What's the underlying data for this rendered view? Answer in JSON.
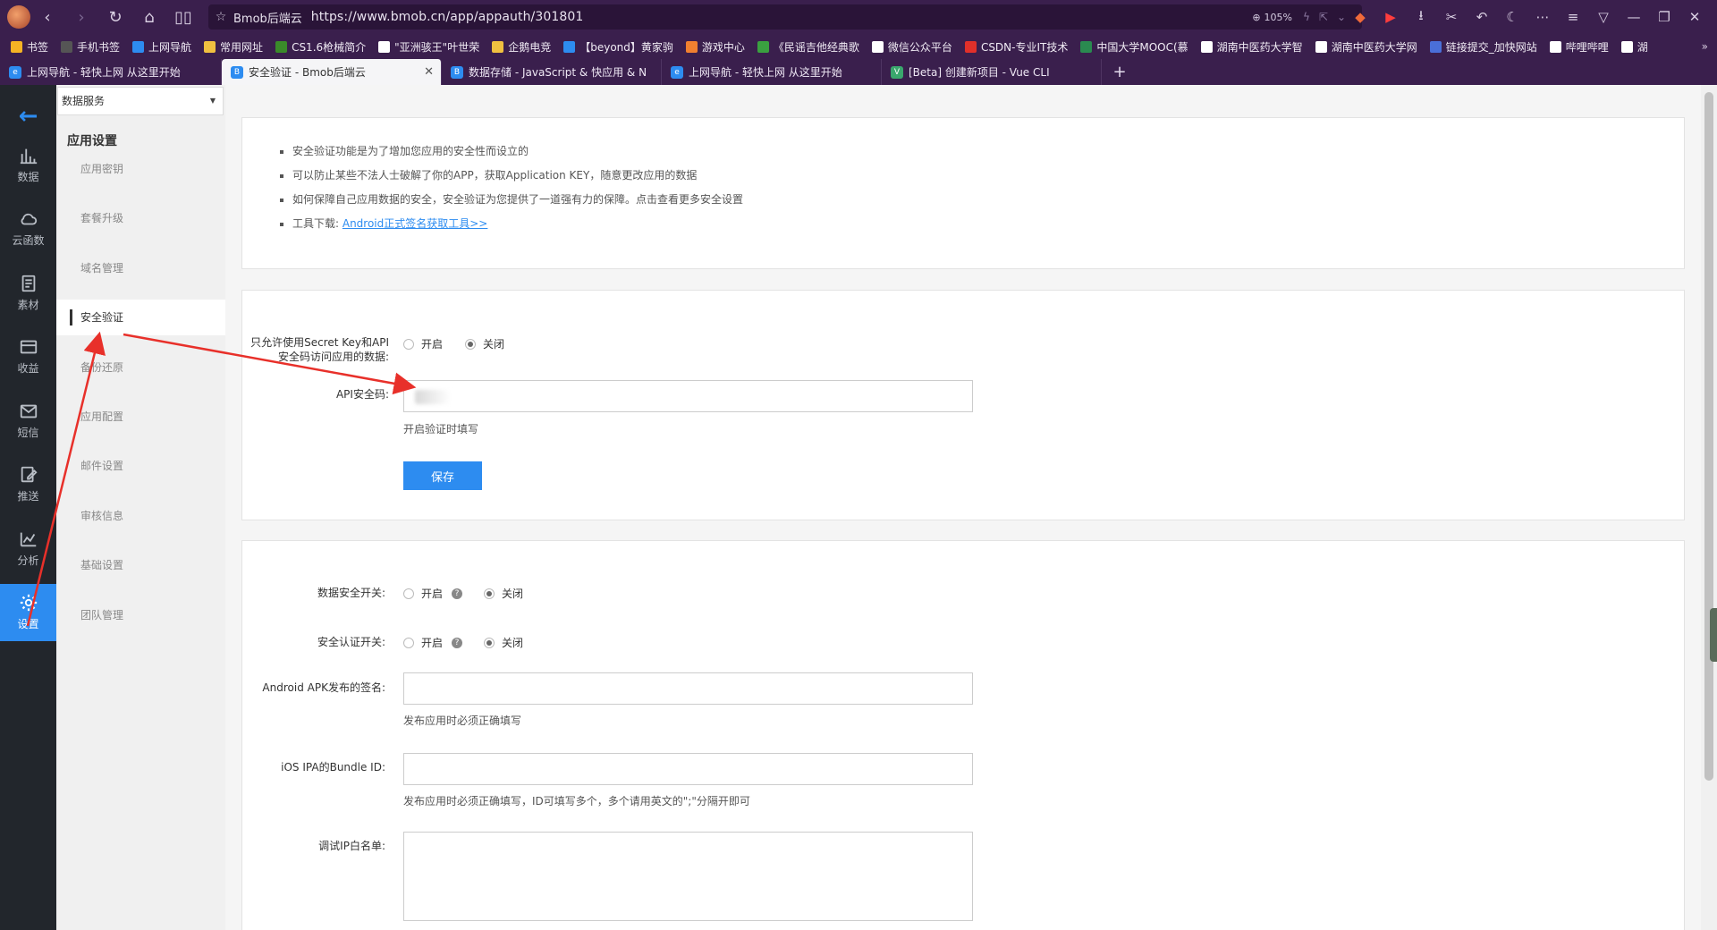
{
  "browser": {
    "page_name": "Bmob后端云",
    "url": "https://www.bmob.cn/app/appauth/301801",
    "zoom": "105%"
  },
  "bookmarks": [
    {
      "label": "书签",
      "color": "#f5b324"
    },
    {
      "label": "手机书签",
      "color": "#555555"
    },
    {
      "label": "上网导航",
      "color": "#2d8cf0"
    },
    {
      "label": "常用网址",
      "color": "#f0c040"
    },
    {
      "label": "CS1.6枪械简介",
      "color": "#3a8a2a"
    },
    {
      "label": "\"亚洲骇王\"叶世荣",
      "color": "#ffffff"
    },
    {
      "label": "企鹅电竞",
      "color": "#f0c040"
    },
    {
      "label": "【beyond】黄家驹",
      "color": "#2d8cf0"
    },
    {
      "label": "游戏中心",
      "color": "#f08030"
    },
    {
      "label": "《民谣吉他经典歌",
      "color": "#3aa040"
    },
    {
      "label": "微信公众平台",
      "color": "#ffffff"
    },
    {
      "label": "CSDN-专业IT技术",
      "color": "#e0302a"
    },
    {
      "label": "中国大学MOOC(慕",
      "color": "#2a8a50"
    },
    {
      "label": "湖南中医药大学智",
      "color": "#ffffff"
    },
    {
      "label": "湖南中医药大学网",
      "color": "#ffffff"
    },
    {
      "label": "链接提交_加快网站",
      "color": "#4a6fd8"
    },
    {
      "label": "哔哩哔哩",
      "color": "#ffffff"
    },
    {
      "label": "湖",
      "color": "#ffffff"
    }
  ],
  "bookmarks_more": "»",
  "tabs": [
    {
      "label": "上网导航 - 轻快上网 从这里开始",
      "fav": "e",
      "color": "#2d8cf0",
      "active": false
    },
    {
      "label": "安全验证 - Bmob后端云",
      "fav": "B",
      "color": "#2d8cf0",
      "active": true
    },
    {
      "label": "数据存储 - JavaScript & 快应用 & N",
      "fav": "B",
      "color": "#2d8cf0",
      "active": false
    },
    {
      "label": "上网导航 - 轻快上网 从这里开始",
      "fav": "e",
      "color": "#2d8cf0",
      "active": false
    },
    {
      "label": "[Beta] 创建新项目 - Vue CLI",
      "fav": "V",
      "color": "#3aa76d",
      "active": false
    }
  ],
  "rail": [
    {
      "label": "数据",
      "icon": "bar-chart-icon",
      "active": false
    },
    {
      "label": "云函数",
      "icon": "cloud-icon",
      "active": false
    },
    {
      "label": "素材",
      "icon": "document-icon",
      "active": false
    },
    {
      "label": "收益",
      "icon": "card-icon",
      "active": false
    },
    {
      "label": "短信",
      "icon": "mail-icon",
      "active": false
    },
    {
      "label": "推送",
      "icon": "edit-icon",
      "active": false
    },
    {
      "label": "分析",
      "icon": "line-chart-icon",
      "active": false
    },
    {
      "label": "设置",
      "icon": "gear-icon",
      "active": true
    }
  ],
  "subnav": {
    "select_value": "数据服务",
    "title": "应用设置",
    "items": [
      {
        "label": "应用密钥",
        "active": false
      },
      {
        "label": "套餐升级",
        "active": false
      },
      {
        "label": "域名管理",
        "active": false
      },
      {
        "label": "安全验证",
        "active": true
      },
      {
        "label": "备份还原",
        "active": false
      },
      {
        "label": "应用配置",
        "active": false
      },
      {
        "label": "邮件设置",
        "active": false
      },
      {
        "label": "审核信息",
        "active": false
      },
      {
        "label": "基础设置",
        "active": false
      },
      {
        "label": "团队管理",
        "active": false
      }
    ]
  },
  "info": {
    "line1": "安全验证功能是为了增加您应用的安全性而设立的",
    "line2": "可以防止某些不法人士破解了你的APP，获取Application KEY，随意更改应用的数据",
    "line3": "如何保障自己应用数据的安全，安全验证为您提供了一道强有力的保障。点击查看更多安全设置",
    "line4_prefix": "工具下载: ",
    "line4_link": "Android正式签名获取工具>>"
  },
  "api_panel": {
    "only_secret_label": "只允许使用Secret Key和API安全码访问应用的数据:",
    "on": "开启",
    "off": "关闭",
    "api_code_label": "API安全码:",
    "api_code_hint": "开启验证时填写",
    "save": "保存"
  },
  "security_panel": {
    "data_switch_label": "数据安全开关:",
    "auth_switch_label": "安全认证开关:",
    "on": "开启",
    "off": "关闭",
    "help": "?",
    "apk_label": "Android APK发布的签名:",
    "apk_hint": "发布应用时必须正确填写",
    "ios_label": "iOS IPA的Bundle ID:",
    "ios_hint": "发布应用时必须正确填写，ID可填写多个，多个请用英文的\";\"分隔开即可",
    "ip_label": "调试IP白名单:"
  },
  "annotation_color": "#e8302a"
}
